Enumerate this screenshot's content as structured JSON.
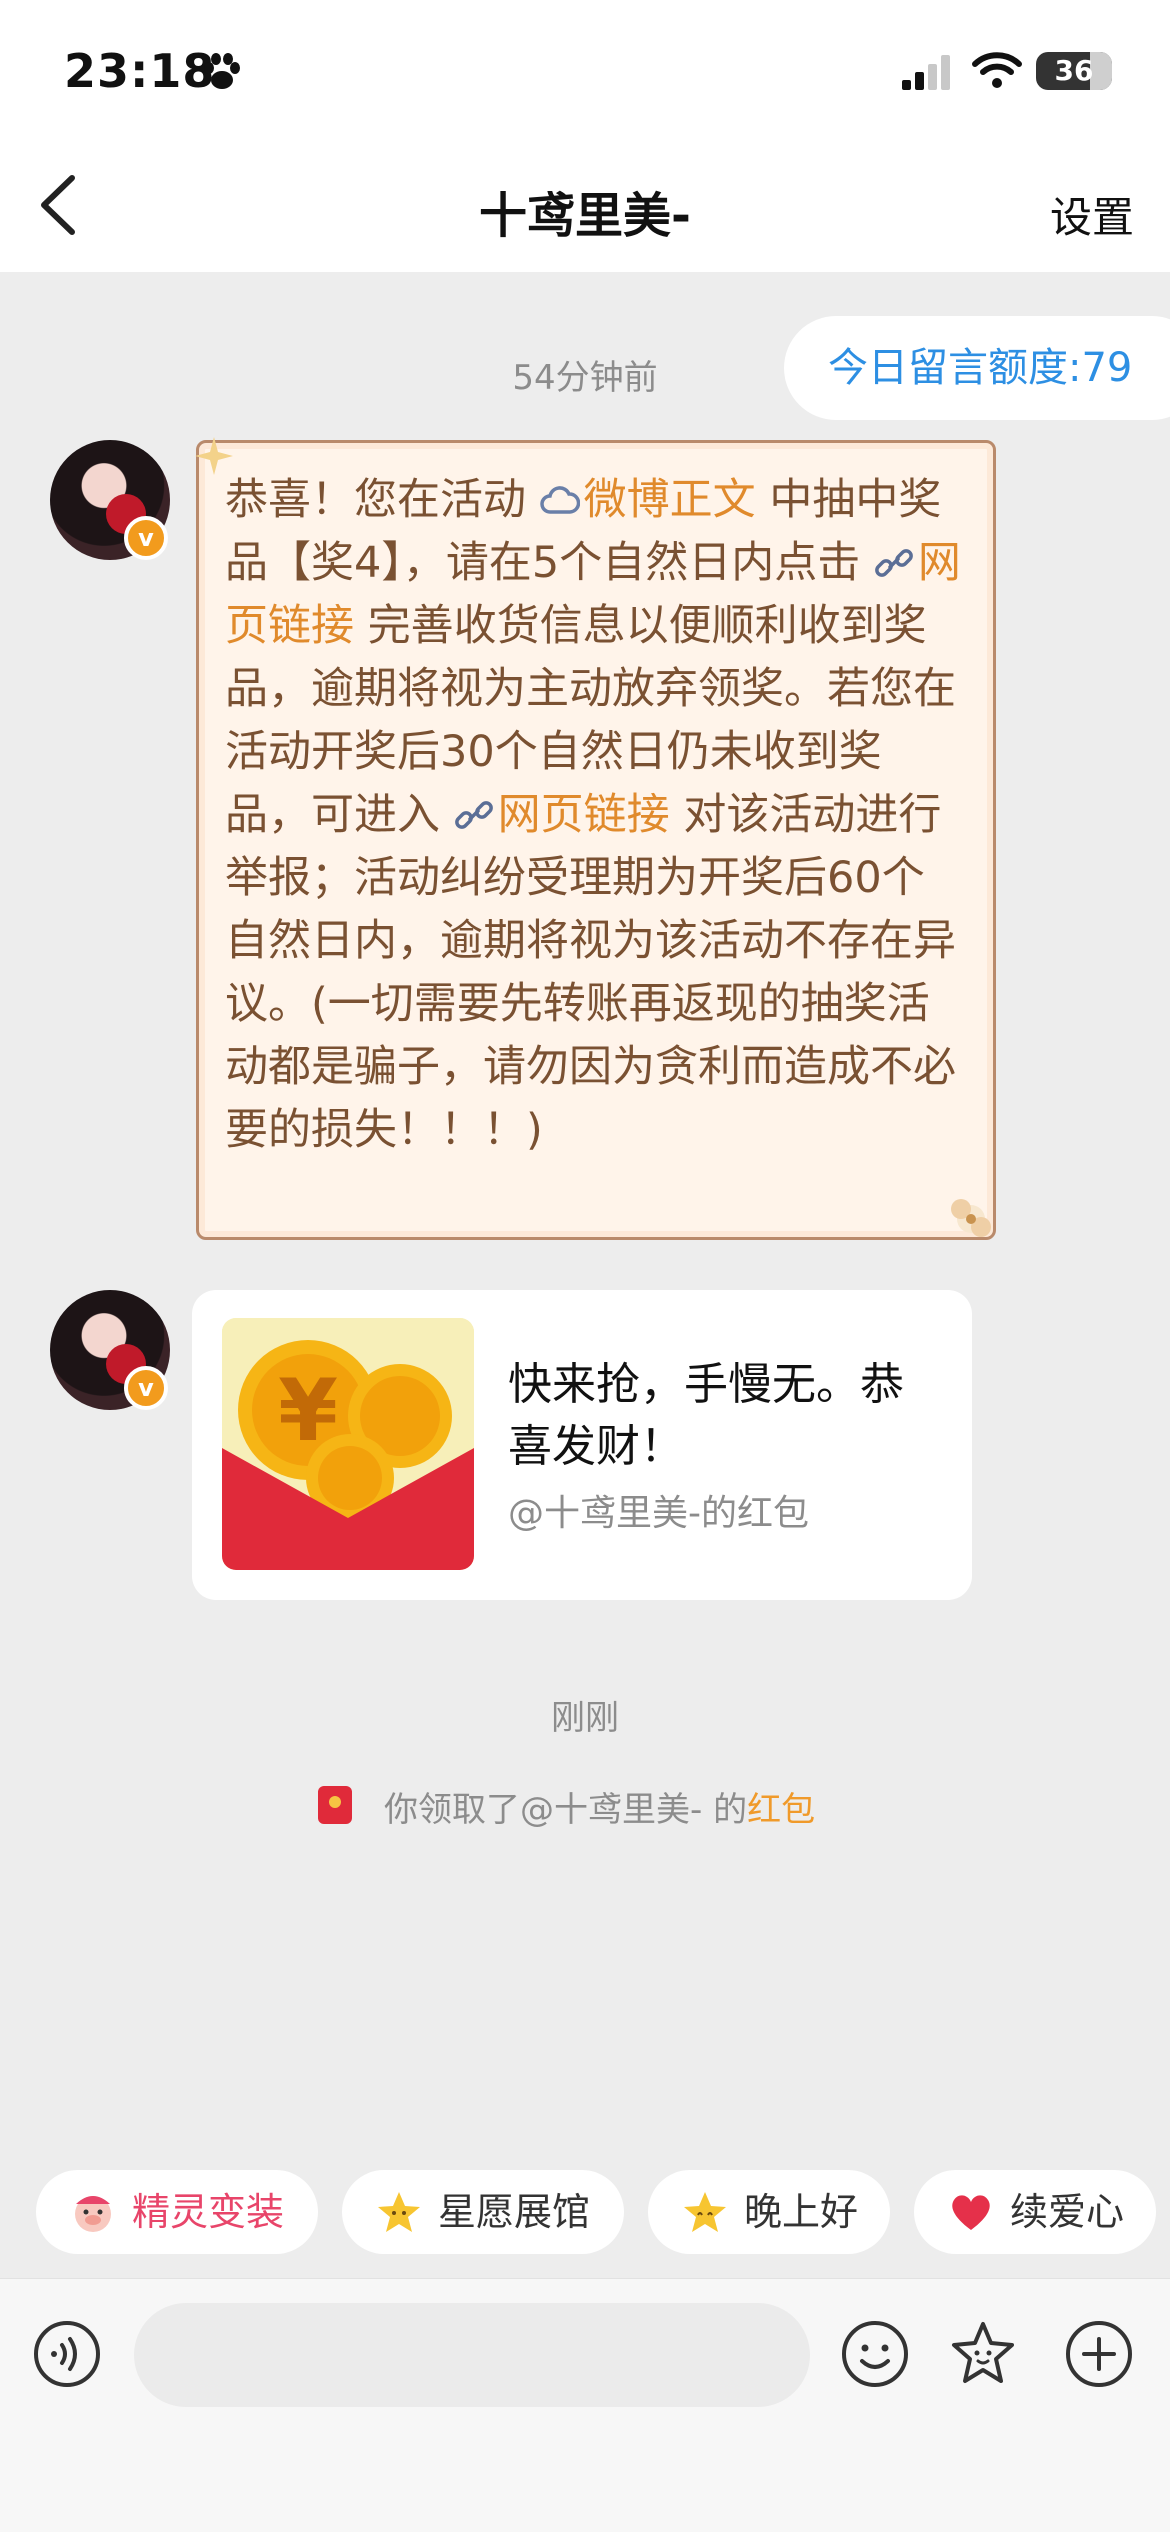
{
  "status_bar": {
    "time": "23:18",
    "battery": "36"
  },
  "nav": {
    "title": "十鸢里美-",
    "settings_label": "设置"
  },
  "quota_label": "今日留言额度:79",
  "messages": {
    "timestamp_1": "54分钟前",
    "notice": {
      "part1": "恭喜！您在活动 ",
      "link1": "微博正文",
      "part2": " 中抽中奖品【奖4】，请在5个自然日内点击 ",
      "link2": "网页链接",
      "part3": " 完善收货信息以便顺利收到奖品，逾期将视为主动放弃领奖。若您在活动开奖后30个自然日仍未收到奖品，可进入 ",
      "link3": "网页链接",
      "part4": " 对该活动进行举报；活动纠纷受理期为开奖后60个自然日内，逾期将视为该活动不存在异议。(一切需要先转账再返现的抽奖活动都是骗子，请勿因为贪利而造成不必要的损失！！！)"
    },
    "red_packet": {
      "title": "快来抢，手慢无。恭喜发财！",
      "subtitle": "@十鸢里美-的红包"
    },
    "timestamp_2": "刚刚",
    "received": {
      "prefix": "你领取了@十鸢里美- 的",
      "link": "红包"
    }
  },
  "chips": [
    {
      "label": "精灵变装",
      "icon": "pig-mascot-icon",
      "color": "#e8456a"
    },
    {
      "label": "星愿展馆",
      "icon": "star-face-icon",
      "color": "#333333"
    },
    {
      "label": "晚上好",
      "icon": "star-face-icon",
      "color": "#333333"
    },
    {
      "label": "续爱心",
      "icon": "heart-icon",
      "color": "#333333"
    }
  ],
  "input_bar": {
    "placeholder": ""
  },
  "colors": {
    "link": "#e08a2c",
    "quota_text": "#2d8fe3",
    "badge": "#f29b1d",
    "red_packet": "#e02a3a"
  }
}
